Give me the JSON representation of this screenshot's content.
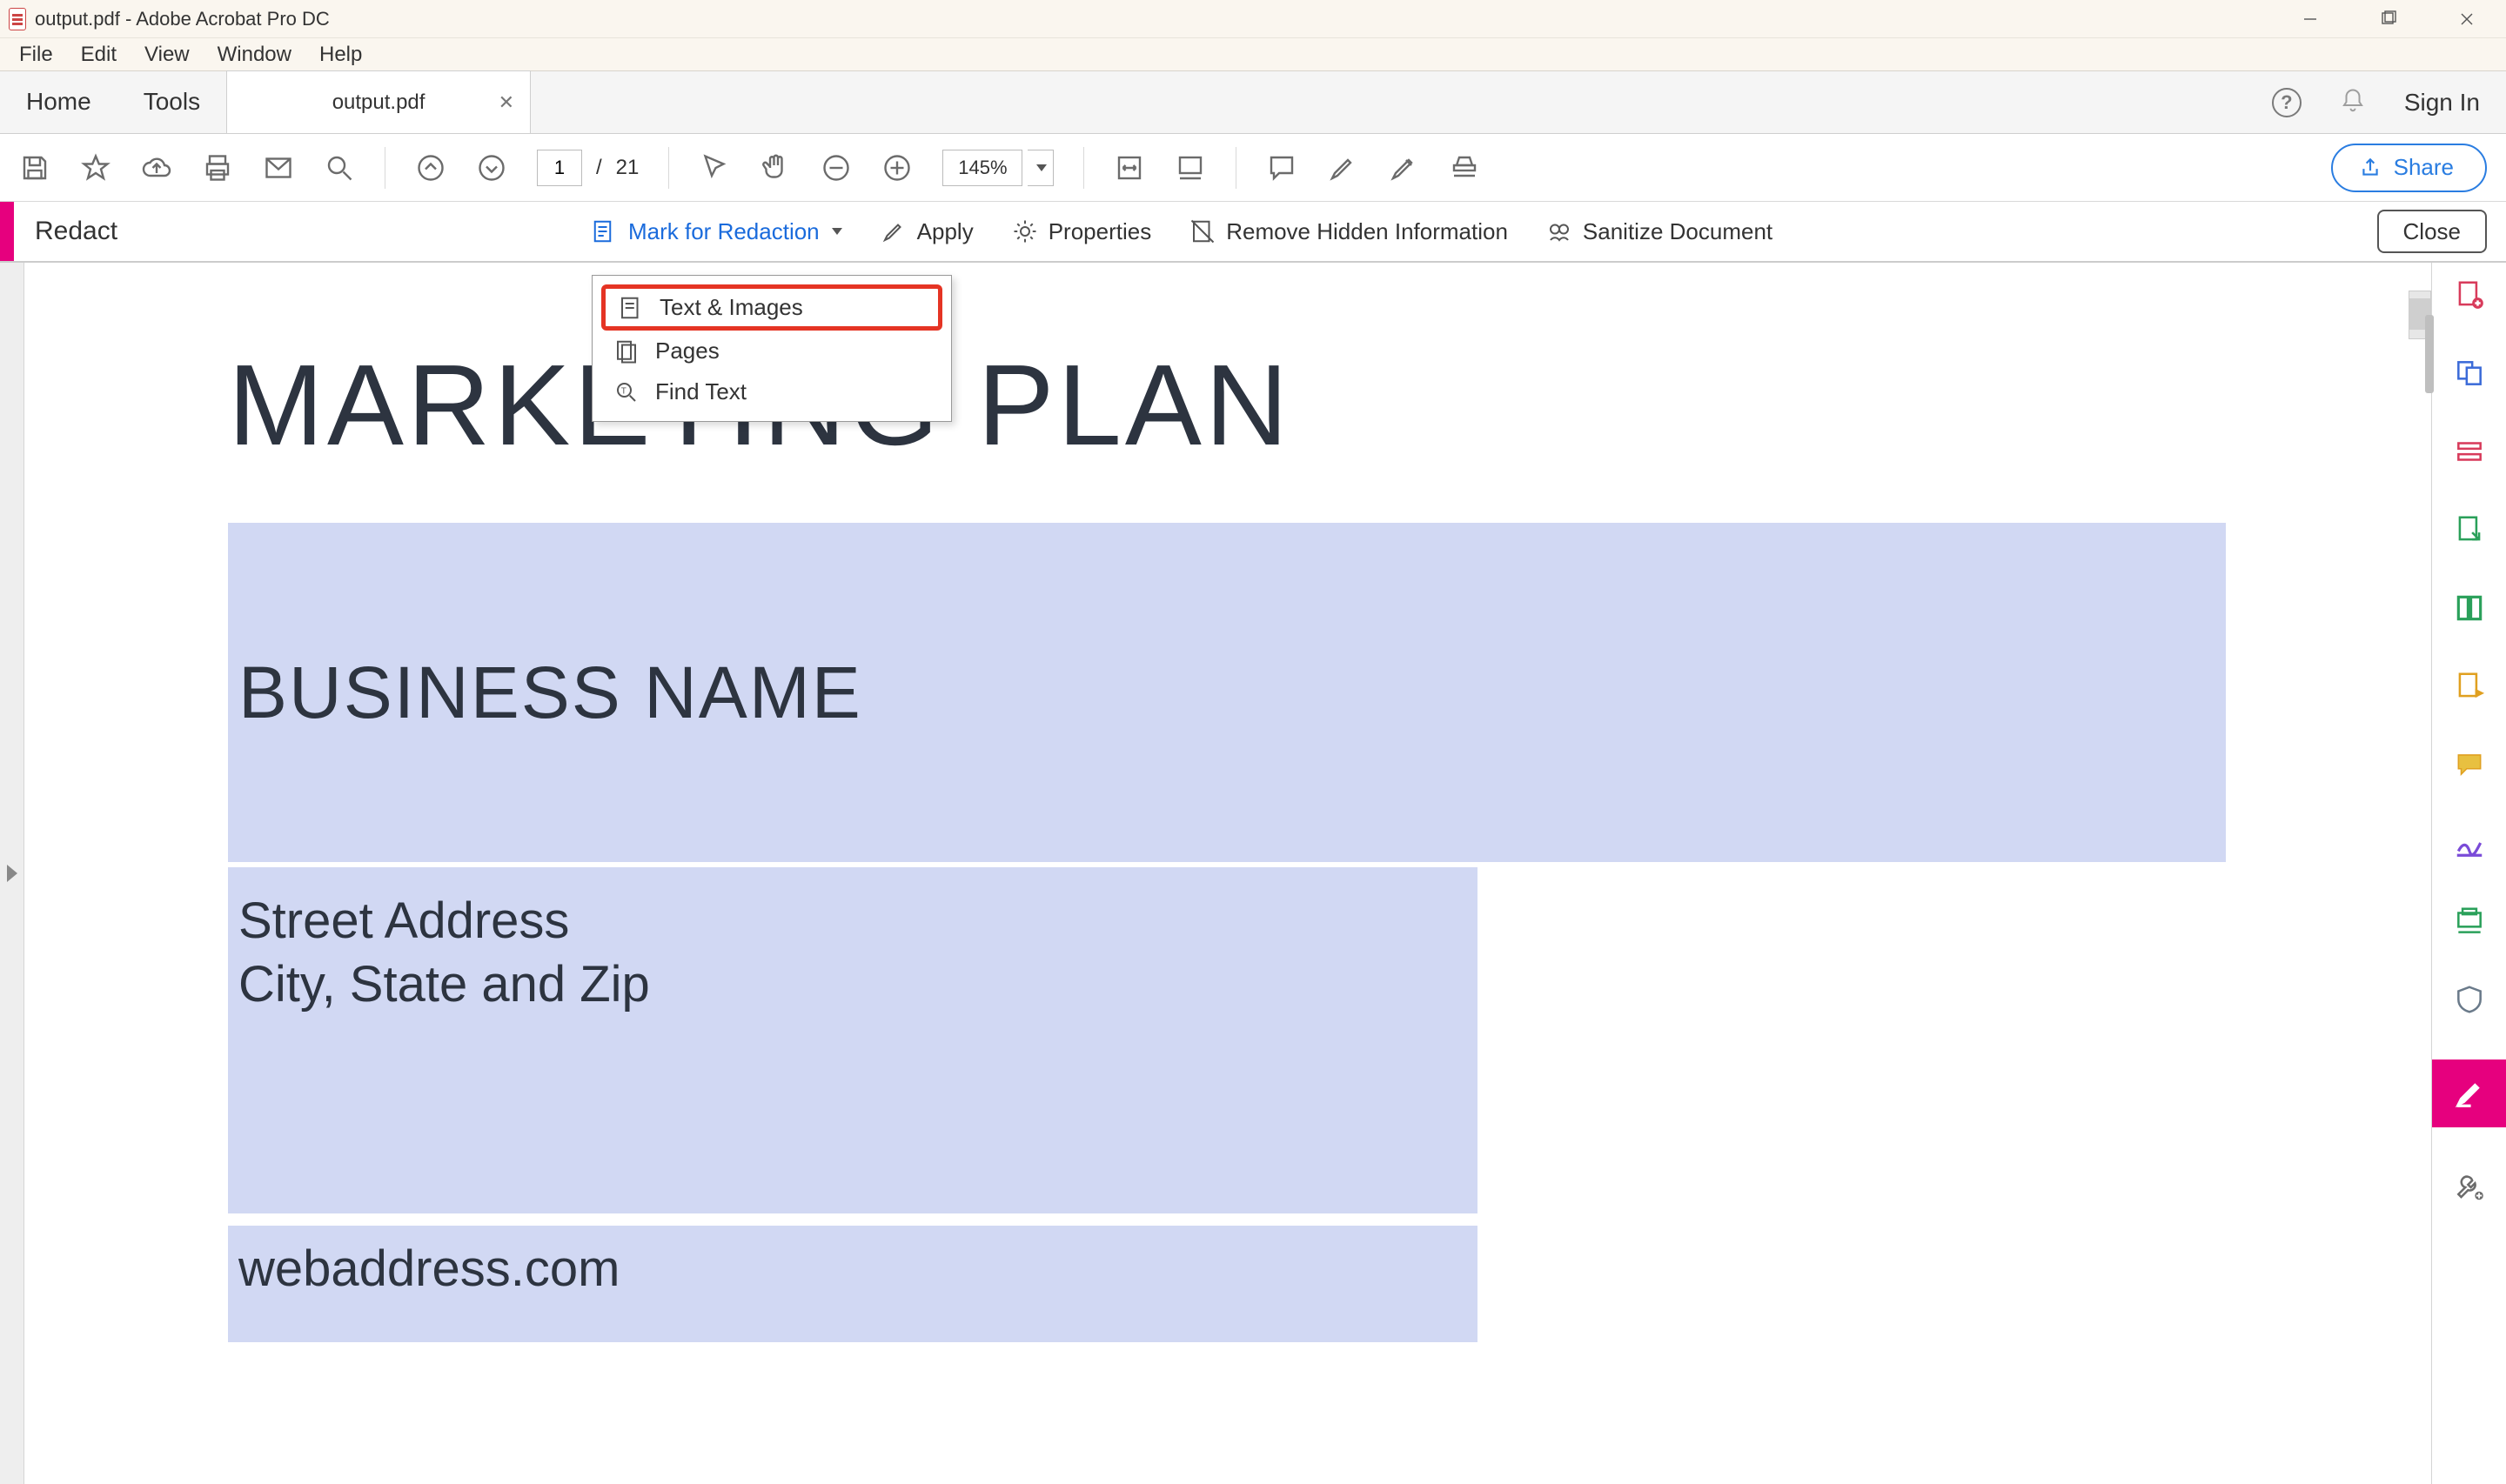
{
  "window": {
    "title": "output.pdf - Adobe Acrobat Pro DC"
  },
  "menu": {
    "file": "File",
    "edit": "Edit",
    "view": "View",
    "window": "Window",
    "help": "Help"
  },
  "tabs": {
    "home": "Home",
    "tools": "Tools",
    "doc": "output.pdf"
  },
  "header_right": {
    "sign_in": "Sign In"
  },
  "toolbar": {
    "page_current": "1",
    "page_sep": "/",
    "page_total": "21",
    "zoom": "145%",
    "share": "Share"
  },
  "redact": {
    "label": "Redact",
    "mark": "Mark for Redaction",
    "apply": "Apply",
    "properties": "Properties",
    "remove": "Remove Hidden Information",
    "sanitize": "Sanitize Document",
    "close": "Close"
  },
  "dropdown": {
    "text_images": "Text & Images",
    "pages": "Pages",
    "find_text": "Find Text"
  },
  "document": {
    "title": "MARKETING PLAN",
    "business": "BUSINESS NAME",
    "addr1": "Street Address",
    "addr2": "City, State and Zip",
    "web": "webaddress.com"
  }
}
